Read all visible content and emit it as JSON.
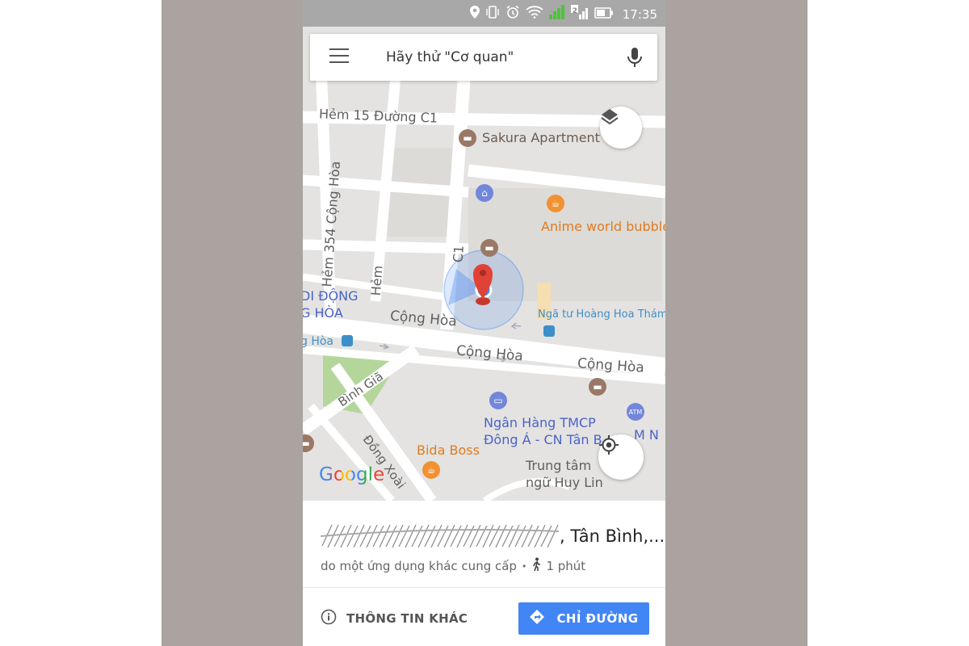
{
  "status_bar": {
    "time": "17:35",
    "icons": [
      "location-icon",
      "vibrate-icon",
      "alarm-icon",
      "wifi-icon",
      "signal-icon",
      "signal-2-icon",
      "battery-icon"
    ],
    "sim_badge": "2"
  },
  "search": {
    "placeholder": "Hãy thử \"Cơ quan\""
  },
  "map": {
    "streets": {
      "hem15": "Hẻm 15 Đường C1",
      "hem354": "Hẻm 354 Cộng Hòa",
      "hem": "Hẻm",
      "c1": "C1",
      "conghoa1": "Cộng Hòa",
      "conghoa2": "Cộng Hòa",
      "conghoa3": "Cộng Hòa",
      "binhgia": "Bình Giã",
      "dongxoai": "Đồng Xoài"
    },
    "places": {
      "sakura": "Sakura Apartment",
      "anime": "Anime world bubble",
      "didong1": "DI ĐỘNG",
      "didong2": "G HÒA",
      "hoa_bus": "g Hòa",
      "nga_tu": "Ngã tư Hoàng Hoa Thám",
      "bank1": "Ngân Hàng TMCP",
      "bank2": "Đông Á - CN Tân B",
      "atm_n": "M N",
      "bida": "Bida Boss",
      "trung1": "Trung tâm",
      "trung2": "ngữ Huy Lin"
    },
    "logo": "Google",
    "colors": {
      "map_bg": "#e4e3e1",
      "street": "#ffffff",
      "park": "#b5d69b",
      "accuracy": "#4285f4",
      "pin": "#e04335"
    }
  },
  "sheet": {
    "address_suffix": ", Tân Bình,...",
    "source_text": "do một ứng dụng khác cung cấp",
    "separator": "•",
    "walk_time": "1 phút",
    "more_info_label": "THÔNG TIN KHÁC",
    "directions_label": "CHỈ ĐƯỜNG",
    "accent": "#4285f4"
  }
}
